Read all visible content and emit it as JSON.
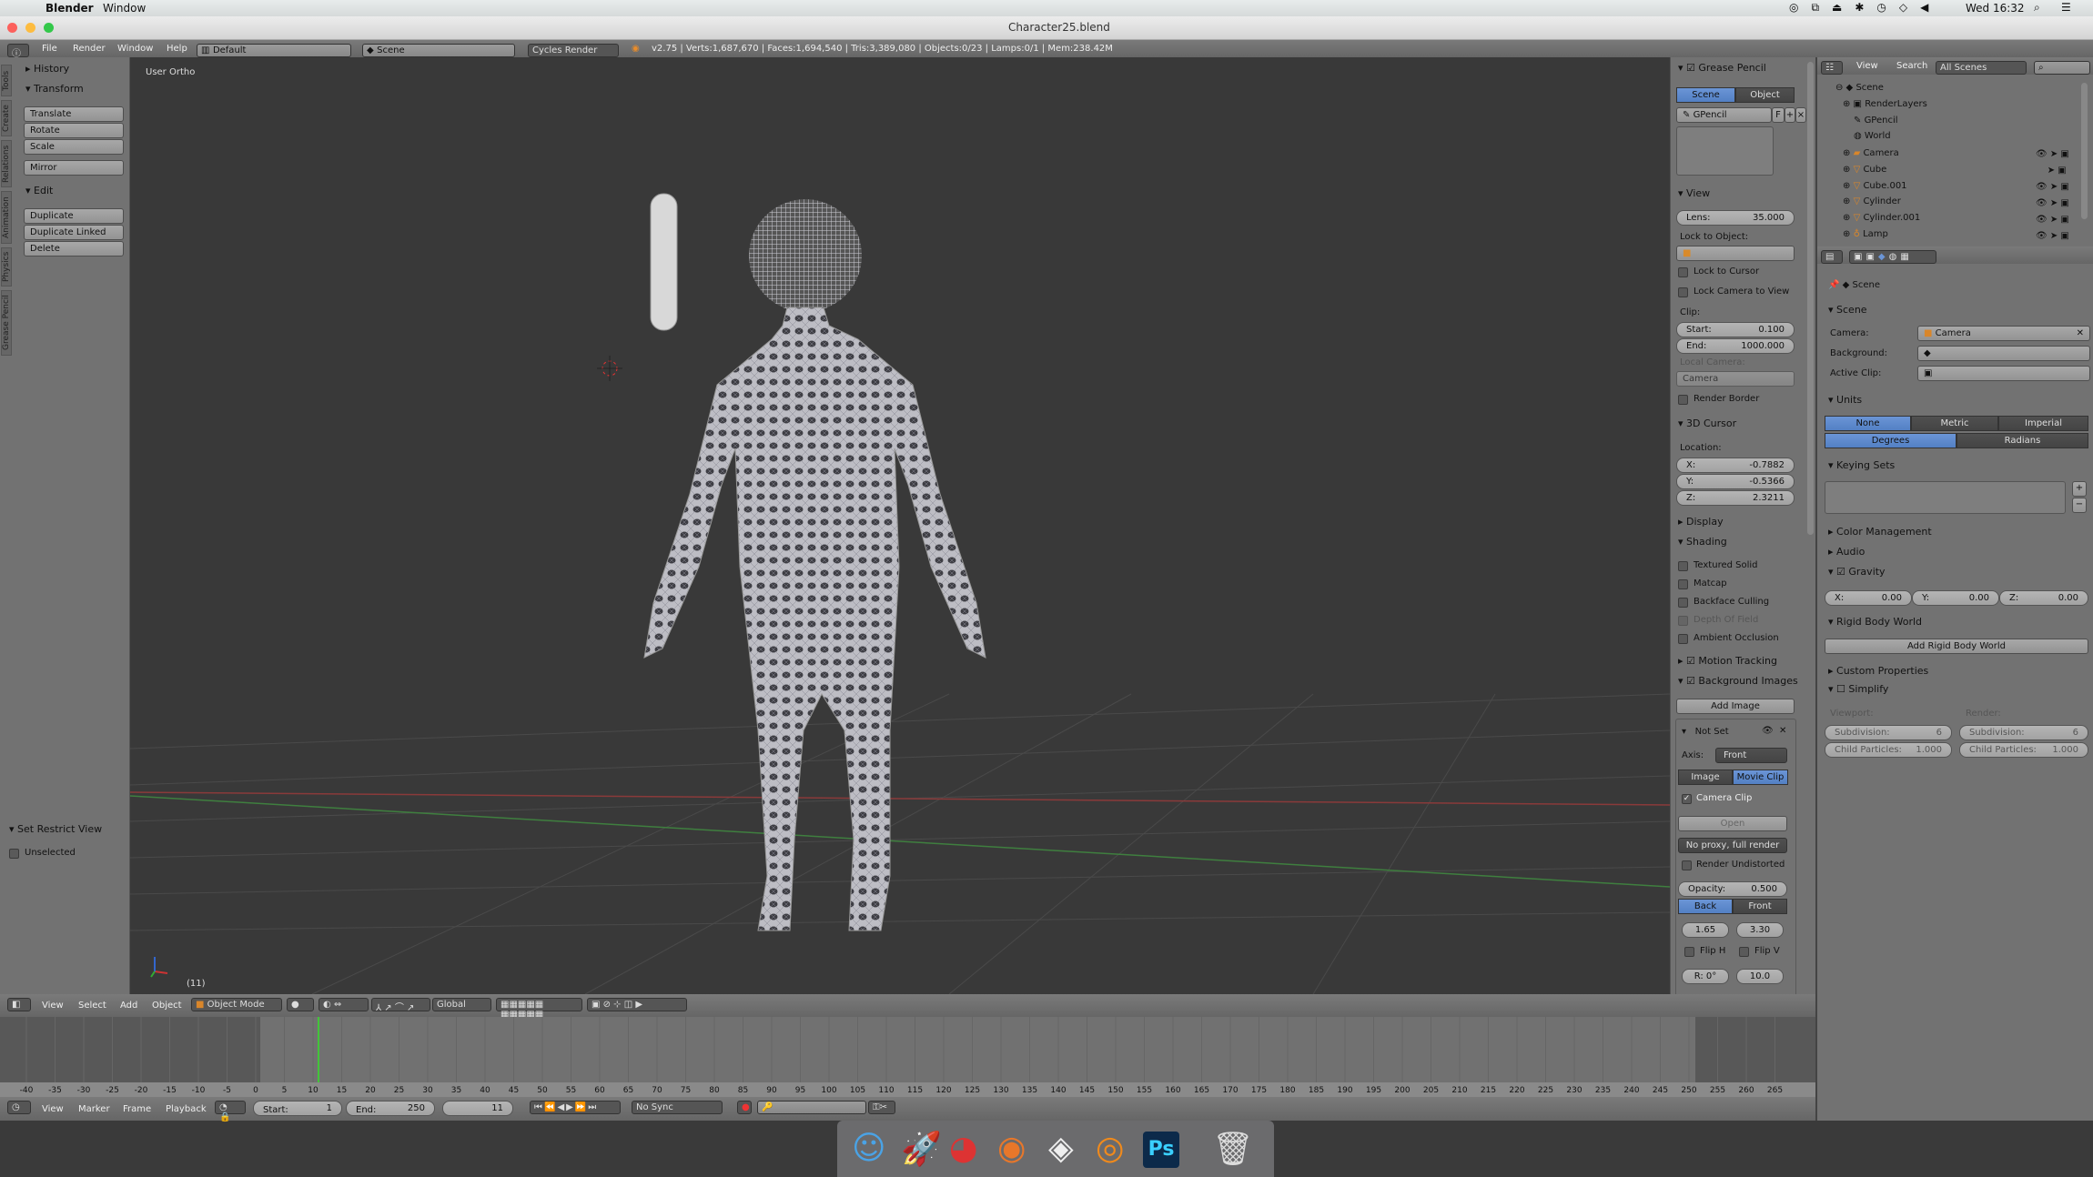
{
  "menubar": {
    "app": "Blender",
    "items": [
      "Window"
    ],
    "clock": "Wed 16:32",
    "status_icons": [
      "creative-cloud-icon",
      "display-icon",
      "eject-icon",
      "bluetooth-icon",
      "time-machine-icon",
      "wifi-icon",
      "volume-icon"
    ]
  },
  "window": {
    "title": "Character25.blend"
  },
  "info_header": {
    "menus": [
      "File",
      "Render",
      "Window",
      "Help"
    ],
    "layout": "Default",
    "scene": "Scene",
    "engine": "Cycles Render",
    "stats": "v2.75 | Verts:1,687,670 | Faces:1,694,540 | Tris:3,389,080 | Objects:0/23 | Lamps:0/1 | Mem:238.42M"
  },
  "toolshelf": {
    "tabs": [
      "Tools",
      "Create",
      "Relations",
      "Animation",
      "Physics",
      "Grease Pencil"
    ],
    "history": "History",
    "transform": "Transform",
    "transform_buttons": [
      "Translate",
      "Rotate",
      "Scale"
    ],
    "mirror": "Mirror",
    "edit": "Edit",
    "edit_buttons": [
      "Duplicate",
      "Duplicate Linked",
      "Delete"
    ],
    "operator": "Set Restrict View",
    "operator_option": "Unselected"
  },
  "viewport": {
    "view_name": "User Ortho",
    "frame_label": "(11)"
  },
  "npanel": {
    "grease_pencil": "Grease Pencil",
    "gp_tabs": [
      "Scene",
      "Object"
    ],
    "gp_name": "GPencil",
    "gp_f": "F",
    "view": "View",
    "lens_label": "Lens:",
    "lens": "35.000",
    "lock_to_object": "Lock to Object:",
    "lock_to_cursor": "Lock to Cursor",
    "lock_camera": "Lock Camera to View",
    "clip": "Clip:",
    "clip_start_label": "Start:",
    "clip_start": "0.100",
    "clip_end_label": "End:",
    "clip_end": "1000.000",
    "local_camera": "Local Camera:",
    "local_camera_value": "Camera",
    "render_border": "Render Border",
    "cursor": "3D Cursor",
    "location": "Location:",
    "x_label": "X:",
    "x": "-0.7882",
    "y_label": "Y:",
    "y": "-0.5366",
    "z_label": "Z:",
    "z": "2.3211",
    "display": "Display",
    "shading": "Shading",
    "shading_options": [
      "Textured Solid",
      "Matcap",
      "Backface Culling",
      "Depth Of Field",
      "Ambient Occlusion"
    ],
    "motion_tracking": "Motion Tracking",
    "background_images": "Background Images",
    "add_image": "Add Image",
    "bg_name": "Not Set",
    "axis_label": "Axis:",
    "axis": "Front",
    "source_tabs": [
      "Image",
      "Movie Clip"
    ],
    "camera_clip": "Camera Clip",
    "open": "Open",
    "proxy": "No proxy, full render",
    "render_undistorted": "Render Undistorted",
    "opacity_label": "Opacity:",
    "opacity": "0.500",
    "depth_tabs": [
      "Back",
      "Front"
    ],
    "offset_x": "1.65",
    "offset_y": "3.30",
    "flip_h": "Flip H",
    "flip_v": "Flip V",
    "rotation": "R: 0°",
    "size": "10.0"
  },
  "outliner": {
    "menus": [
      "View",
      "Search"
    ],
    "filter": "All Scenes",
    "items": [
      "Scene",
      "RenderLayers",
      "GPencil",
      "World",
      "Camera",
      "Cube",
      "Cube.001",
      "Cylinder",
      "Cylinder.001",
      "Lamp"
    ]
  },
  "properties": {
    "context": "Scene",
    "scene_panel": "Scene",
    "camera_label": "Camera:",
    "camera": "Camera",
    "background_label": "Background:",
    "active_clip_label": "Active Clip:",
    "units": "Units",
    "unit_systems": [
      "None",
      "Metric",
      "Imperial"
    ],
    "rotation_units": [
      "Degrees",
      "Radians"
    ],
    "keying_sets": "Keying Sets",
    "color_management": "Color Management",
    "audio": "Audio",
    "gravity": "Gravity",
    "gx_label": "X:",
    "gx": "0.00",
    "gy_label": "Y:",
    "gy": "0.00",
    "gz_label": "Z:",
    "gz": "0.00",
    "rigid_body_world": "Rigid Body World",
    "add_rigid_body_world": "Add Rigid Body World",
    "custom_properties": "Custom Properties",
    "simplify": "Simplify",
    "viewport": "Viewport:",
    "render": "Render:",
    "subdivision_label": "Subdivision:",
    "subdivision_viewport": "6",
    "subdivision_render": "6",
    "child_particles_label": "Child Particles:",
    "child_particles_viewport": "1.000",
    "child_particles_render": "1.000"
  },
  "view3d_header": {
    "menus": [
      "View",
      "Select",
      "Add",
      "Object"
    ],
    "mode": "Object Mode",
    "orientation": "Global"
  },
  "timeline": {
    "ticks": [
      -40,
      -35,
      -30,
      -25,
      -20,
      -15,
      -10,
      -5,
      0,
      5,
      10,
      15,
      20,
      25,
      30,
      35,
      40,
      45,
      50,
      55,
      60,
      65,
      70,
      75,
      80,
      85,
      90,
      95,
      100,
      105,
      110,
      115,
      120,
      125,
      130,
      135,
      140,
      145,
      150,
      155,
      160,
      165,
      170,
      175,
      180,
      185,
      190,
      195,
      200,
      205,
      210,
      215,
      220,
      225,
      230,
      235,
      240,
      245,
      250,
      255,
      260,
      265
    ],
    "current_frame": 11,
    "menus": [
      "View",
      "Marker",
      "Frame",
      "Playback"
    ],
    "start_label": "Start:",
    "start": "1",
    "end_label": "End:",
    "end": "250",
    "frame": "11",
    "sync": "No Sync"
  },
  "dock": {
    "icons": [
      "finder-icon",
      "launchpad-icon",
      "chrome-icon",
      "firefox-icon",
      "unity-icon",
      "blender-icon",
      "photoshop-icon",
      "trash-icon"
    ]
  },
  "colors": {
    "accent": "#5680c4",
    "viewport_bg": "#3a3a3a",
    "panel": "#727272",
    "current_frame": "#43c43a",
    "x_axis": "#a33a3a",
    "y_axis": "#3f8f3f"
  }
}
